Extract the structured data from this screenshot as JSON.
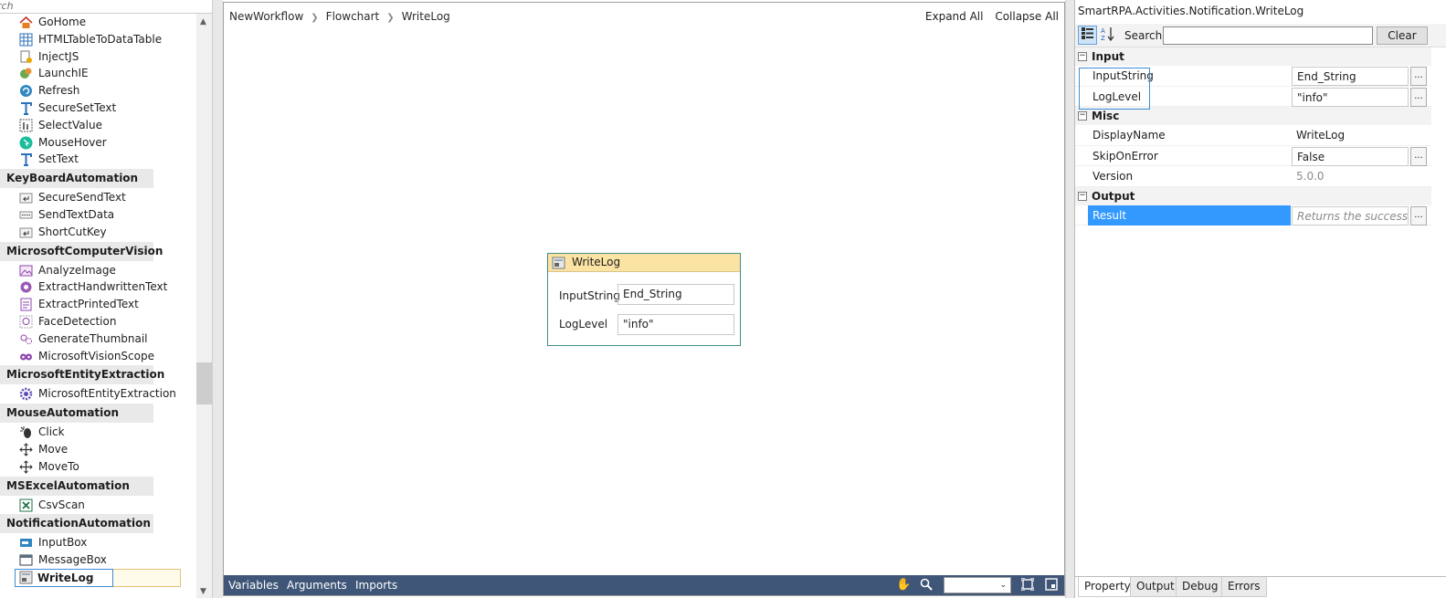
{
  "toolbox": {
    "search_placeholder": "rch",
    "sections": [
      {
        "type": "item",
        "label": "GoHome",
        "icon": "home-icon"
      },
      {
        "type": "item",
        "label": "HTMLTableToDataTable",
        "icon": "table-grid-icon"
      },
      {
        "type": "item",
        "label": "InjectJS",
        "icon": "script-icon"
      },
      {
        "type": "item",
        "label": "LaunchIE",
        "icon": "browser-launch-icon"
      },
      {
        "type": "item",
        "label": "Refresh",
        "icon": "refresh-icon"
      },
      {
        "type": "item",
        "label": "SecureSetText",
        "icon": "text-t-icon"
      },
      {
        "type": "item",
        "label": "SelectValue",
        "icon": "select-list-icon"
      },
      {
        "type": "item",
        "label": "MouseHover",
        "icon": "hover-pointer-icon"
      },
      {
        "type": "item",
        "label": "SetText",
        "icon": "text-t-icon"
      },
      {
        "type": "cat",
        "label": "KeyBoardAutomation"
      },
      {
        "type": "item",
        "label": "SecureSendText",
        "icon": "keyboard-enter-icon"
      },
      {
        "type": "item",
        "label": "SendTextData",
        "icon": "send-text-icon"
      },
      {
        "type": "item",
        "label": "ShortCutKey",
        "icon": "keyboard-enter-icon"
      },
      {
        "type": "cat",
        "label": "MicrosoftComputerVision"
      },
      {
        "type": "item",
        "label": "AnalyzeImage",
        "icon": "image-icon"
      },
      {
        "type": "item",
        "label": "ExtractHandwrittenText",
        "icon": "handwriting-icon"
      },
      {
        "type": "item",
        "label": "ExtractPrintedText",
        "icon": "document-text-icon"
      },
      {
        "type": "item",
        "label": "FaceDetection",
        "icon": "face-icon"
      },
      {
        "type": "item",
        "label": "GenerateThumbnail",
        "icon": "thumbnail-icon"
      },
      {
        "type": "item",
        "label": "MicrosoftVisionScope",
        "icon": "vision-eyes-icon"
      },
      {
        "type": "cat",
        "label": "MicrosoftEntityExtraction"
      },
      {
        "type": "item",
        "label": "MicrosoftEntityExtraction",
        "icon": "gear-icon"
      },
      {
        "type": "cat",
        "label": "MouseAutomation"
      },
      {
        "type": "item",
        "label": "Click",
        "icon": "mouse-click-icon"
      },
      {
        "type": "item",
        "label": "Move",
        "icon": "move-arrows-icon"
      },
      {
        "type": "item",
        "label": "MoveTo",
        "icon": "move-arrows-icon"
      },
      {
        "type": "cat",
        "label": "MSExcelAutomation"
      },
      {
        "type": "item",
        "label": "CsvScan",
        "icon": "excel-icon"
      },
      {
        "type": "cat",
        "label": "NotificationAutomation"
      },
      {
        "type": "item",
        "label": "InputBox",
        "icon": "input-box-icon"
      },
      {
        "type": "item",
        "label": "MessageBox",
        "icon": "message-box-icon"
      },
      {
        "type": "item",
        "label": "WriteLog",
        "icon": "write-log-icon",
        "selected": true
      }
    ]
  },
  "designer": {
    "breadcrumb": [
      "NewWorkflow",
      "Flowchart",
      "WriteLog"
    ],
    "expand_all": "Expand All",
    "collapse_all": "Collapse All",
    "activity": {
      "title": "WriteLog",
      "fields": [
        {
          "label": "InputString",
          "value": "End_String"
        },
        {
          "label": "LogLevel",
          "value": "\"info\""
        }
      ]
    },
    "statusbar": {
      "tabs": [
        "Variables",
        "Arguments",
        "Imports"
      ]
    }
  },
  "properties": {
    "title": "SmartRPA.Activities.Notification.WriteLog",
    "search_label": "Search:",
    "search_value": "",
    "clear_label": "Clear",
    "categories": [
      {
        "name": "Input",
        "rows": [
          {
            "name": "InputString",
            "value": "End_String",
            "kind": "boxed",
            "ellipsis": true
          },
          {
            "name": "LogLevel",
            "value": "\"info\"",
            "kind": "boxed",
            "ellipsis": true
          }
        ]
      },
      {
        "name": "Misc",
        "rows": [
          {
            "name": "DisplayName",
            "value": "WriteLog",
            "kind": "plain",
            "ellipsis": false
          },
          {
            "name": "SkipOnError",
            "value": "False",
            "kind": "boxed",
            "ellipsis": true
          },
          {
            "name": "Version",
            "value": "5.0.0",
            "kind": "dim",
            "ellipsis": false
          }
        ]
      },
      {
        "name": "Output",
        "rows": [
          {
            "name": "Result",
            "value": "Returns the success sta",
            "kind": "ghost",
            "ellipsis": true,
            "selected": true
          }
        ]
      }
    ],
    "bottom_tabs": [
      "Property",
      "Output",
      "Debug",
      "Errors"
    ],
    "active_tab": "Property"
  }
}
